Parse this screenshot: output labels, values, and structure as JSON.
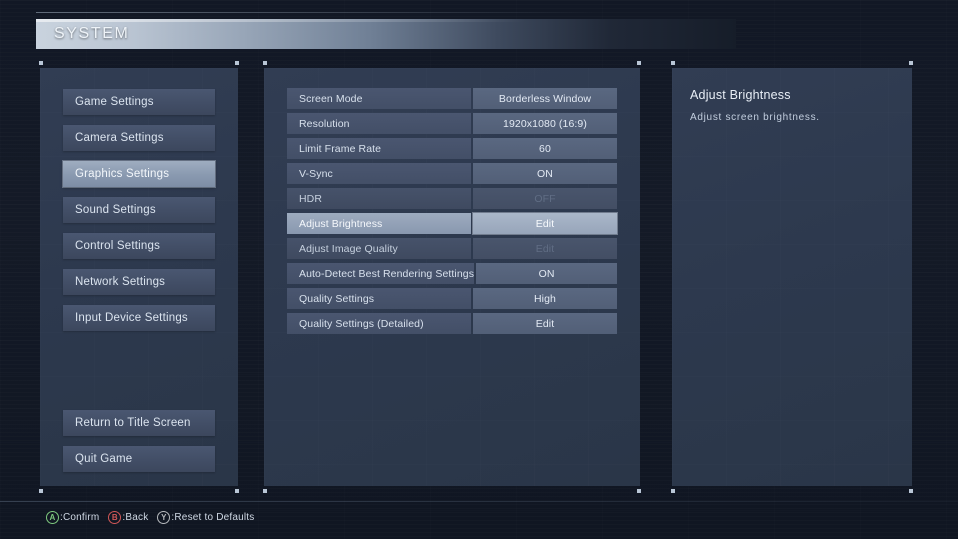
{
  "header": {
    "title": "SYSTEM"
  },
  "sidebar": {
    "items": [
      {
        "label": "Game Settings",
        "selected": false
      },
      {
        "label": "Camera Settings",
        "selected": false
      },
      {
        "label": "Graphics Settings",
        "selected": true
      },
      {
        "label": "Sound Settings",
        "selected": false
      },
      {
        "label": "Control Settings",
        "selected": false
      },
      {
        "label": "Network Settings",
        "selected": false
      },
      {
        "label": "Input Device Settings",
        "selected": false
      }
    ],
    "bottom_items": [
      {
        "label": "Return to Title Screen"
      },
      {
        "label": "Quit Game"
      }
    ]
  },
  "settings": {
    "rows": [
      {
        "label": "Screen Mode",
        "value": "Borderless Window",
        "selected": false,
        "disabled": false
      },
      {
        "label": "Resolution",
        "value": "1920x1080 (16:9)",
        "selected": false,
        "disabled": false
      },
      {
        "label": "Limit Frame Rate",
        "value": "60",
        "selected": false,
        "disabled": false
      },
      {
        "label": "V-Sync",
        "value": "ON",
        "selected": false,
        "disabled": false
      },
      {
        "label": "HDR",
        "value": "OFF",
        "selected": false,
        "disabled": true
      },
      {
        "label": "Adjust Brightness",
        "value": "Edit",
        "selected": true,
        "disabled": false
      },
      {
        "label": "Adjust Image Quality",
        "value": "Edit",
        "selected": false,
        "disabled": true
      },
      {
        "label": "Auto-Detect Best Rendering Settings",
        "value": "ON",
        "selected": false,
        "disabled": false
      },
      {
        "label": "Quality Settings",
        "value": "High",
        "selected": false,
        "disabled": false
      },
      {
        "label": "Quality Settings (Detailed)",
        "value": "Edit",
        "selected": false,
        "disabled": false
      }
    ]
  },
  "description": {
    "title": "Adjust Brightness",
    "text": "Adjust screen brightness."
  },
  "footer": {
    "hints": [
      {
        "button": "A",
        "glyph": "A",
        "label": ":Confirm",
        "color": "#7ec87e",
        "icon": "gamepad-a-icon"
      },
      {
        "button": "B",
        "glyph": "B",
        "label": ":Back",
        "color": "#d05757",
        "icon": "gamepad-b-icon"
      },
      {
        "button": "Y",
        "glyph": "Y",
        "label": ":Reset to Defaults",
        "color": "#b6b9bd",
        "icon": "gamepad-y-icon"
      }
    ]
  }
}
